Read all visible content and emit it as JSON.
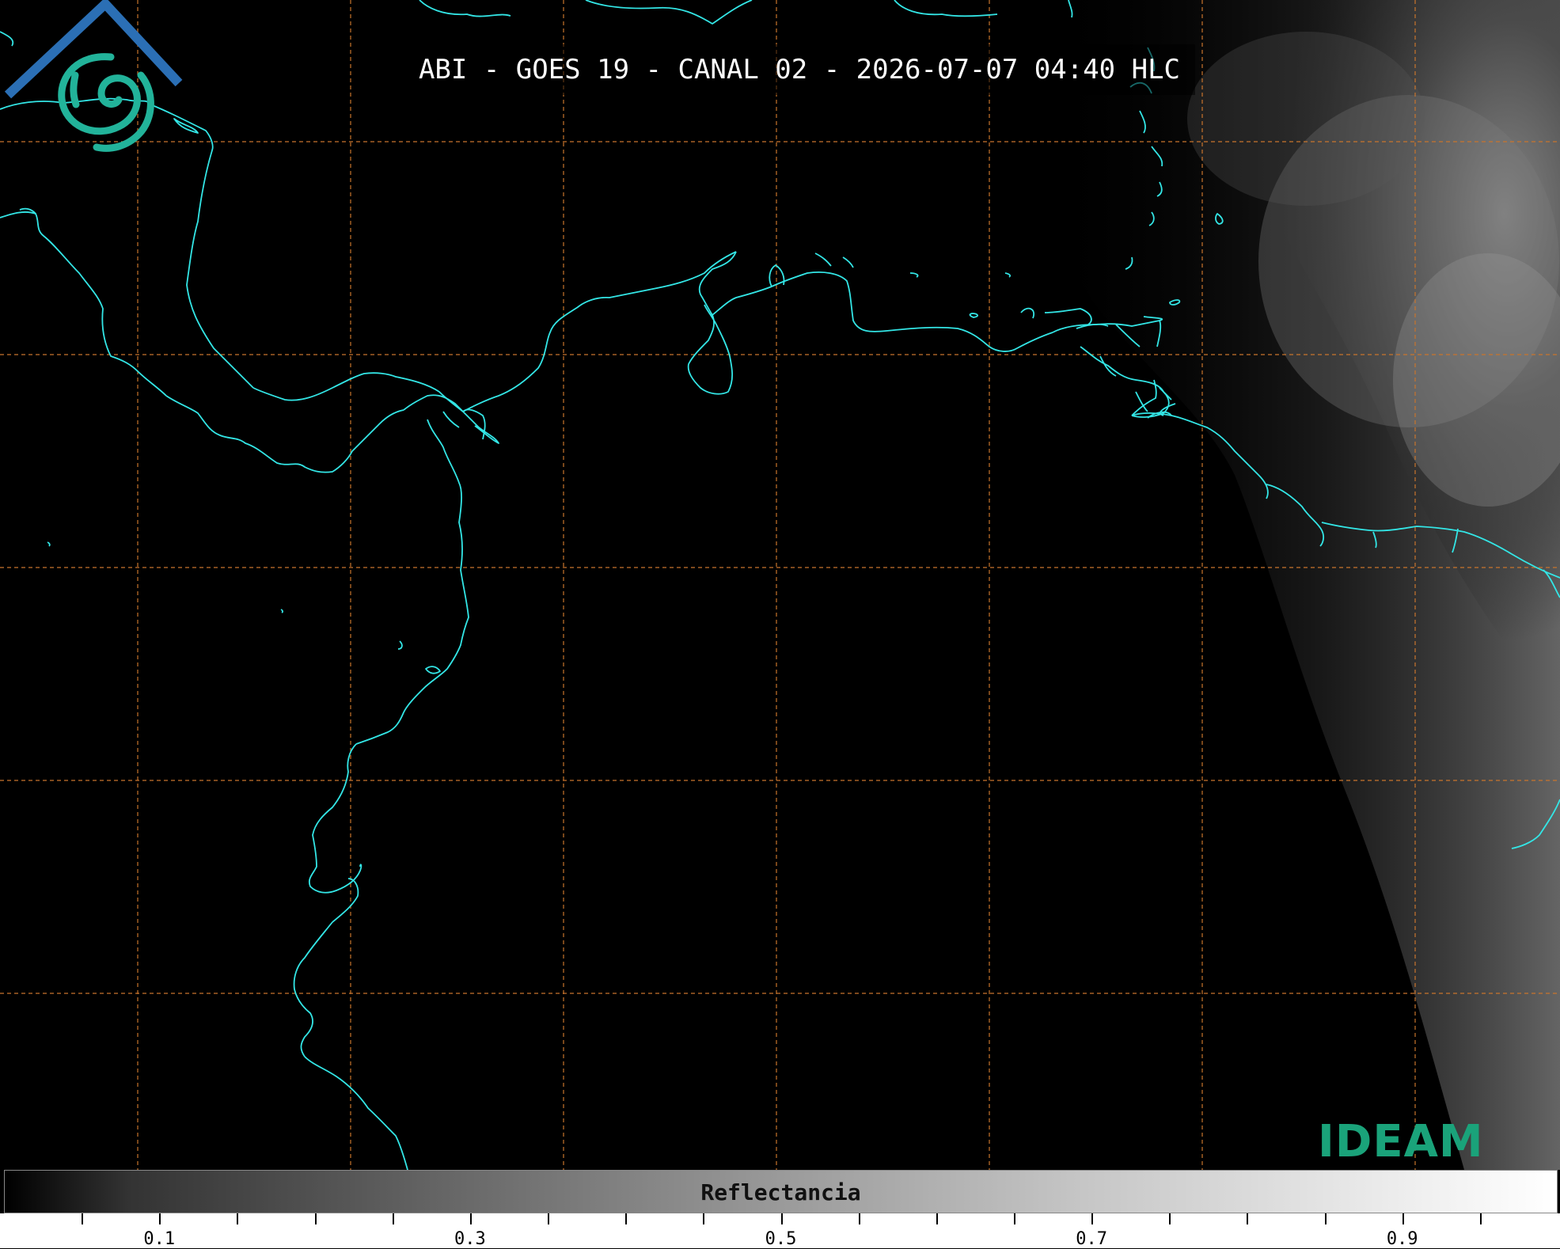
{
  "title": "ABI - GOES 19 - CANAL 02 - 2026-07-07 04:40 HLC",
  "colorbar": {
    "label": "Reflectancia",
    "tick_labels": [
      "0.1",
      "0.3",
      "0.5",
      "0.7",
      "0.9"
    ],
    "range": [
      0.0,
      1.0
    ],
    "major_tick_step": 0.05,
    "colors": {
      "low": "#000000",
      "high": "#ffffff"
    }
  },
  "map": {
    "coastline_color": "#33e6e6",
    "gridline_color": "#c8742c",
    "gridline_style": "dashed",
    "background": "#000000",
    "cloud_region": "east"
  },
  "logo": {
    "text": "IDEAM",
    "colors": {
      "roof": "#2b6fb5",
      "swirl": "#22b39a",
      "text": "#1aa37a"
    }
  }
}
